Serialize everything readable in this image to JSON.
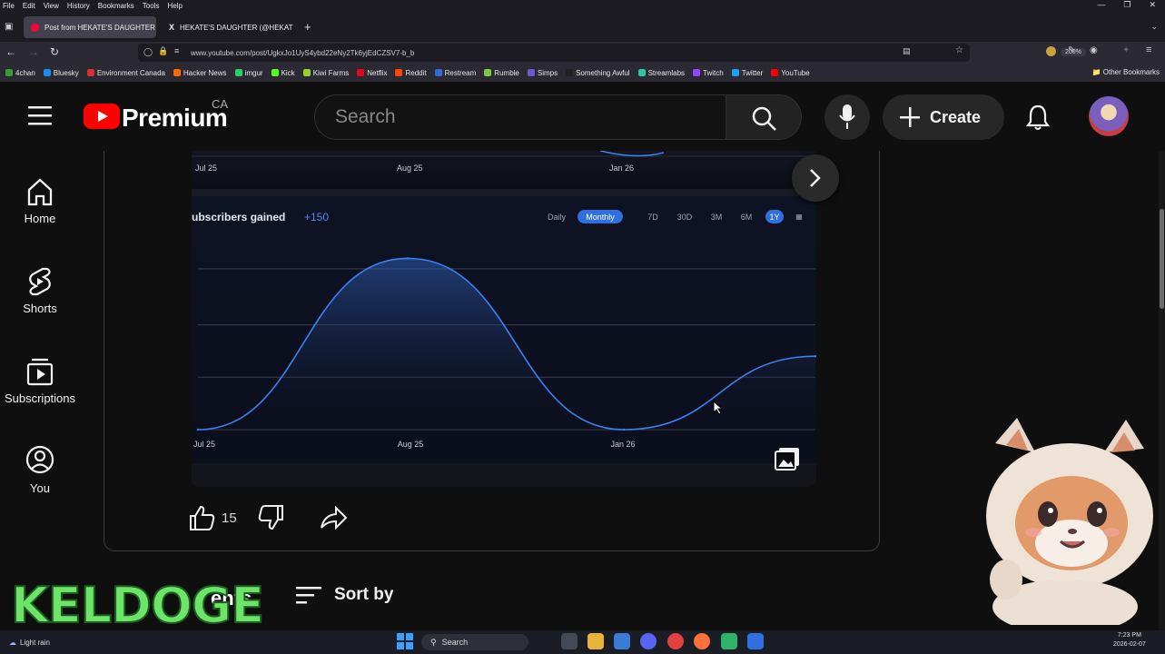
{
  "browser": {
    "menu": [
      "File",
      "Edit",
      "View",
      "History",
      "Bookmarks",
      "Tools",
      "Help"
    ],
    "tabs": [
      {
        "title": "Post from HEKATE'S DAUGHTER",
        "active": true,
        "favicon_color": "#ff0033"
      },
      {
        "title": "HEKATE'S DAUGHTER (@HEKAT",
        "active": false,
        "favicon_color": "#ffffff"
      }
    ],
    "new_tab": "+",
    "url": "www.youtube.com/post/UgkxJo1UyS4ybd22eNy2Tk6yjEdCZSV7-b_b",
    "zoom": "200%",
    "bookmarks": [
      {
        "label": "4chan",
        "color": "#3a9a3a"
      },
      {
        "label": "Bluesky",
        "color": "#1d8cf0"
      },
      {
        "label": "Environment Canada",
        "color": "#d83030"
      },
      {
        "label": "Hacker News",
        "color": "#ff6600"
      },
      {
        "label": "imgur",
        "color": "#2ecc71"
      },
      {
        "label": "Kick",
        "color": "#53fc18"
      },
      {
        "label": "Kiwi Farms",
        "color": "#9acd32"
      },
      {
        "label": "Netflix",
        "color": "#e50914"
      },
      {
        "label": "Reddit",
        "color": "#ff4500"
      },
      {
        "label": "Restream",
        "color": "#2d6cdf"
      },
      {
        "label": "Rumble",
        "color": "#85c742"
      },
      {
        "label": "Simps",
        "color": "#6a5acd"
      },
      {
        "label": "Something Awful",
        "color": "#222222"
      },
      {
        "label": "Streamlabs",
        "color": "#31c3a2"
      },
      {
        "label": "Twitch",
        "color": "#9146ff"
      },
      {
        "label": "Twitter",
        "color": "#1da1f2"
      },
      {
        "label": "YouTube",
        "color": "#ff0000"
      }
    ],
    "other_bookmarks": "Other Bookmarks"
  },
  "youtube": {
    "logo": "Premium",
    "region": "CA",
    "search_placeholder": "Search",
    "create_label": "Create",
    "accent": "#ff0000"
  },
  "sidebar": [
    {
      "label": "Home",
      "icon": "home-icon"
    },
    {
      "label": "Shorts",
      "icon": "shorts-icon"
    },
    {
      "label": "Subscriptions",
      "icon": "subscriptions-icon"
    },
    {
      "label": "You",
      "icon": "you-icon"
    }
  ],
  "post": {
    "likes": "15",
    "comments_label": "ents",
    "sort_label": "Sort by"
  },
  "chart_panel": {
    "metric_label": "ubscribers gained",
    "metric_value": "+150",
    "granularity": [
      "Daily",
      "Monthly"
    ],
    "granularity_selected": "Monthly",
    "ranges": [
      "7D",
      "30D",
      "3M",
      "6M",
      "1Y"
    ],
    "range_selected": "1Y",
    "top_x_ticks": [
      "Jul 25",
      "Aug 25",
      "Jan 26"
    ],
    "line_color": "#3b82f6",
    "selected_color": "#2f6fe0"
  },
  "chart_data": {
    "type": "area",
    "x": [
      "Jul 25",
      "Aug 25",
      "Jan 26"
    ],
    "x_ticks": [
      "Jul 25",
      "Aug 25",
      "Jan 26"
    ],
    "points": [
      {
        "x": 0.0,
        "y": 0
      },
      {
        "x": 0.34,
        "y": 2.8
      },
      {
        "x": 0.69,
        "y": 0
      },
      {
        "x": 1.0,
        "y": 1.2
      }
    ],
    "ylim": [
      0,
      3
    ],
    "grid": true,
    "title": "",
    "xlabel": "",
    "ylabel": ""
  },
  "overlay": {
    "watermark": "KELDOGE"
  },
  "taskbar": {
    "weather": "Light rain",
    "search": "Search",
    "time": "7:23 PM",
    "date": "2026-02-07"
  }
}
